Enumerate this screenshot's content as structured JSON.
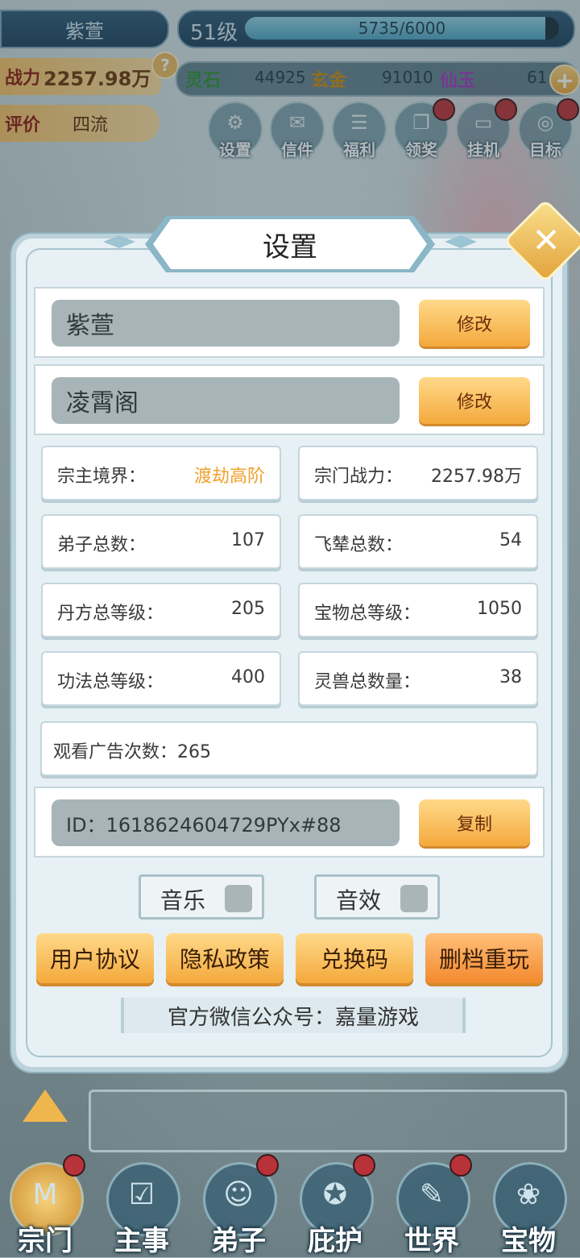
{
  "player": {
    "name": "紫萱",
    "level": "51级",
    "exp_text": "5735/6000",
    "exp_fraction": 0.9558
  },
  "stats_bar": {
    "power_label": "战力",
    "power_value": "2257.98万",
    "help": "?",
    "resources": [
      {
        "label": "灵石",
        "value": "44925",
        "color": "#2f8f3a"
      },
      {
        "label": "玄金",
        "value": "91010",
        "color": "#c98a12"
      },
      {
        "label": "仙玉",
        "value": "61",
        "color": "#a03abf"
      }
    ],
    "add": "+",
    "rating_label": "评价",
    "rating_value": "四流"
  },
  "top_icons": [
    {
      "label": "设置",
      "icon": "gear-icon",
      "glyph": "⚙",
      "dot": false
    },
    {
      "label": "信件",
      "icon": "mail-icon",
      "glyph": "✉",
      "dot": false
    },
    {
      "label": "福利",
      "icon": "gift-icon",
      "glyph": "☰",
      "dot": false
    },
    {
      "label": "领奖",
      "icon": "reward-icon",
      "glyph": "❐",
      "dot": true
    },
    {
      "label": "挂机",
      "icon": "idle-icon",
      "glyph": "▭",
      "dot": true
    },
    {
      "label": "目标",
      "icon": "target-icon",
      "glyph": "◎",
      "dot": true
    }
  ],
  "dialog": {
    "title": "设置",
    "close": "✕",
    "name_field": "紫萱",
    "sect_field": "凌霄阁",
    "modify": "修改",
    "stats": [
      {
        "key": "宗主境界：",
        "value": "渡劫高阶",
        "highlight": true
      },
      {
        "key": "宗门战力：",
        "value": "2257.98万",
        "highlight": false
      },
      {
        "key": "弟子总数：",
        "value": "107",
        "highlight": false
      },
      {
        "key": "飞辇总数：",
        "value": "54",
        "highlight": false
      },
      {
        "key": "丹方总等级：",
        "value": "205",
        "highlight": false
      },
      {
        "key": "宝物总等级：",
        "value": "1050",
        "highlight": false
      },
      {
        "key": "功法总等级：",
        "value": "400",
        "highlight": false
      },
      {
        "key": "灵兽总数量：",
        "value": "38",
        "highlight": false
      }
    ],
    "ad_count": "观看广告次数：265",
    "id_field": "ID：1618624604729PYx#88",
    "copy": "复制",
    "music": "音乐",
    "sound": "音效",
    "buttons": [
      "用户协议",
      "隐私政策",
      "兑换码",
      "删档重玩"
    ],
    "wechat": "官方微信公众号：嘉量游戏"
  },
  "bottom_nav": [
    {
      "label": "宗门",
      "icon": "sect-icon",
      "glyph": "M",
      "dot": true,
      "active": true
    },
    {
      "label": "主事",
      "icon": "task-icon",
      "glyph": "☑",
      "dot": false,
      "active": false
    },
    {
      "label": "弟子",
      "icon": "disciple-icon",
      "glyph": "☺",
      "dot": true,
      "active": false
    },
    {
      "label": "庇护",
      "icon": "shield-icon",
      "glyph": "✪",
      "dot": true,
      "active": false
    },
    {
      "label": "世界",
      "icon": "world-icon",
      "glyph": "✎",
      "dot": true,
      "active": false
    },
    {
      "label": "宝物",
      "icon": "treasure-icon",
      "glyph": "❀",
      "dot": false,
      "active": false
    }
  ]
}
